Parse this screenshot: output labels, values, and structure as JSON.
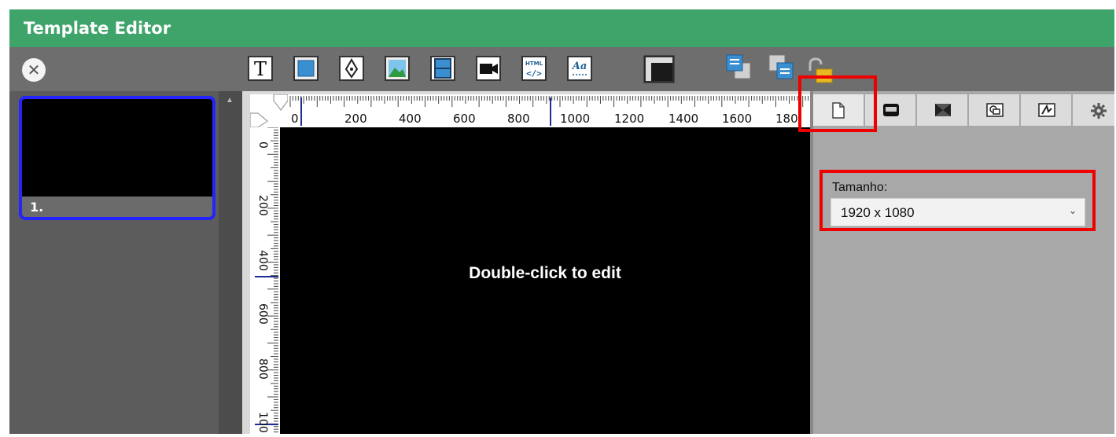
{
  "window": {
    "title": "Template Editor"
  },
  "toolbar": {
    "close_icon": "close-icon",
    "tools": [
      {
        "name": "text-tool",
        "icon": "T"
      },
      {
        "name": "rectangle-tool"
      },
      {
        "name": "pen-tool"
      },
      {
        "name": "image-tool"
      },
      {
        "name": "video-frame-tool"
      },
      {
        "name": "camera-tool"
      },
      {
        "name": "html-tool",
        "icon": "HTML"
      },
      {
        "name": "font-tool",
        "icon": "Aa"
      },
      {
        "name": "ruler-tool"
      },
      {
        "name": "bring-forward-tool"
      },
      {
        "name": "send-backward-tool"
      },
      {
        "name": "lock-tool"
      }
    ]
  },
  "thumbnails": [
    {
      "label": "1."
    }
  ],
  "ruler": {
    "horizontal_labels": [
      "0",
      "200",
      "400",
      "600",
      "800",
      "1000",
      "1200",
      "1400",
      "1600",
      "180"
    ],
    "vertical_labels": [
      "0",
      "200",
      "400",
      "600",
      "800",
      "100"
    ]
  },
  "canvas": {
    "placeholder": "Double-click to edit"
  },
  "properties": {
    "tabs": [
      "page-icon",
      "layer-icon",
      "transition-icon",
      "shapes-icon",
      "style-icon",
      "gear-icon"
    ],
    "size_label": "Tamanho:",
    "size_value": "1920 x 1080"
  },
  "colors": {
    "title_bar": "#3ea46a",
    "highlight": "#ee0000",
    "thumbnail_border": "#2424ff"
  }
}
